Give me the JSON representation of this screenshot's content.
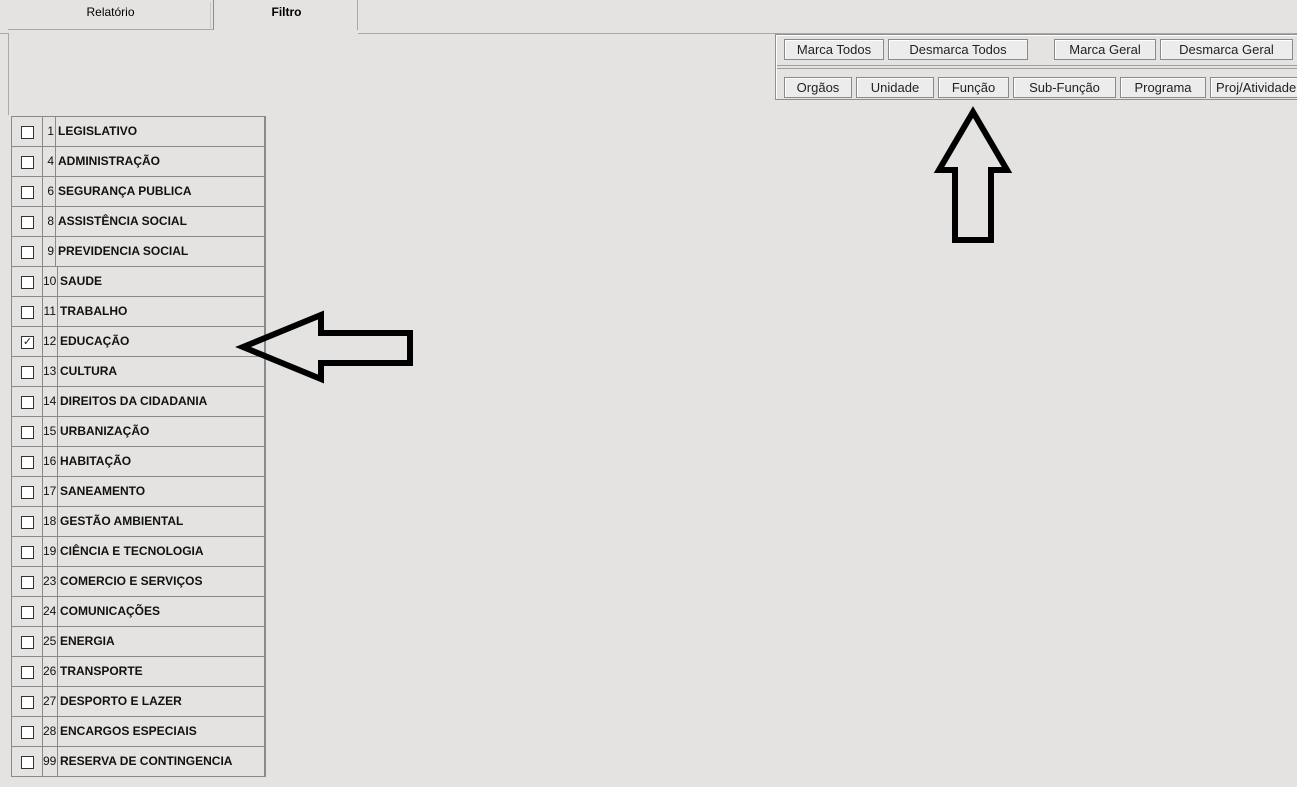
{
  "tabs": {
    "relatorio": "Relatório",
    "filtro": "Filtro"
  },
  "toolbar": {
    "row1": [
      "Marca Todos",
      "Desmarca Todos",
      "Marca Geral",
      "Desmarca Geral"
    ],
    "row2": [
      "Orgãos",
      "Unidade",
      "Função",
      "Sub-Função",
      "Programa",
      "Proj/Atividade"
    ]
  },
  "functions": [
    {
      "code": "1",
      "name": "LEGISLATIVO",
      "checked": false
    },
    {
      "code": "4",
      "name": "ADMINISTRAÇÃO",
      "checked": false
    },
    {
      "code": "6",
      "name": "SEGURANÇA PUBLICA",
      "checked": false
    },
    {
      "code": "8",
      "name": "ASSISTÊNCIA SOCIAL",
      "checked": false
    },
    {
      "code": "9",
      "name": "PREVIDENCIA SOCIAL",
      "checked": false
    },
    {
      "code": "10",
      "name": "SAUDE",
      "checked": false
    },
    {
      "code": "11",
      "name": "TRABALHO",
      "checked": false
    },
    {
      "code": "12",
      "name": "EDUCAÇÃO",
      "checked": true
    },
    {
      "code": "13",
      "name": "CULTURA",
      "checked": false
    },
    {
      "code": "14",
      "name": "DIREITOS DA CIDADANIA",
      "checked": false
    },
    {
      "code": "15",
      "name": "URBANIZAÇÃO",
      "checked": false
    },
    {
      "code": "16",
      "name": "HABITAÇÃO",
      "checked": false
    },
    {
      "code": "17",
      "name": "SANEAMENTO",
      "checked": false
    },
    {
      "code": "18",
      "name": "GESTÃO AMBIENTAL",
      "checked": false
    },
    {
      "code": "19",
      "name": "CIÊNCIA E TECNOLOGIA",
      "checked": false
    },
    {
      "code": "23",
      "name": "COMERCIO E SERVIÇOS",
      "checked": false
    },
    {
      "code": "24",
      "name": "COMUNICAÇÕES",
      "checked": false
    },
    {
      "code": "25",
      "name": "ENERGIA",
      "checked": false
    },
    {
      "code": "26",
      "name": "TRANSPORTE",
      "checked": false
    },
    {
      "code": "27",
      "name": "DESPORTO E LAZER",
      "checked": false
    },
    {
      "code": "28",
      "name": "ENCARGOS ESPECIAIS",
      "checked": false
    },
    {
      "code": "99",
      "name": "RESERVA DE CONTINGENCIA",
      "checked": false
    }
  ],
  "annotations": {
    "up_arrow": "arrow-up-outline",
    "left_arrow": "arrow-left-outline"
  }
}
